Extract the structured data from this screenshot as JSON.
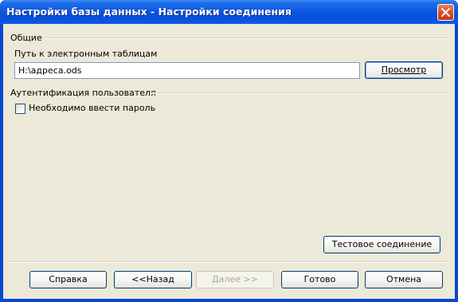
{
  "window": {
    "title": "Настройки базы данных - Настройки соединения"
  },
  "general": {
    "group_label": "Общие",
    "path_label": "Путь к электронным таблицам",
    "path_value": "H:\\адреса.ods",
    "browse_label": "Просмотр"
  },
  "auth": {
    "group_label": "Аутентификация пользователя",
    "password_required_label": "Необходимо ввести пароль",
    "password_required_checked": false
  },
  "test_connection_label": "Тестовое соединение",
  "footer": {
    "help_label": "Справка",
    "back_label": "<<Назад",
    "next_label": "Далее >>",
    "finish_label": "Готово",
    "cancel_label": "Отмена"
  }
}
